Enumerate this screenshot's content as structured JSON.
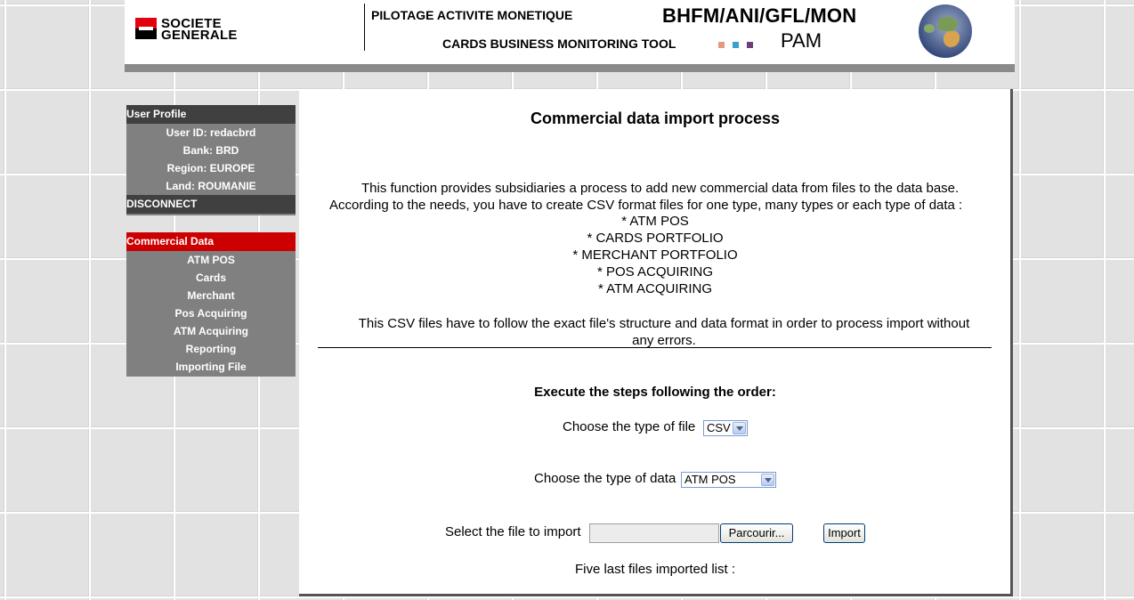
{
  "header": {
    "logo": {
      "line1": "SOCIETE",
      "line2": "GENERALE"
    },
    "title_fr": "PILOTAGE ACTIVITE MONETIQUE",
    "title_en": "CARDS BUSINESS MONITORING TOOL",
    "code": "BHFM/ANI/GFL/MON",
    "abbrev": "PAM",
    "dot_colors": [
      "#e39b7b",
      "#3aa0c9",
      "#6a3f7a"
    ],
    "globe_icon": "globe-icon"
  },
  "sidebar": {
    "profile": {
      "heading": "User Profile",
      "items": [
        {
          "label": "User ID: redacbrd"
        },
        {
          "label": "Bank: BRD"
        },
        {
          "label": "Region: EUROPE"
        },
        {
          "label": "Land: ROUMANIE"
        }
      ],
      "disconnect": "DISCONNECT"
    },
    "commercial": {
      "heading": "Commercial Data",
      "items": [
        {
          "label": "ATM POS"
        },
        {
          "label": "Cards"
        },
        {
          "label": "Merchant"
        },
        {
          "label": "Pos Acquiring"
        },
        {
          "label": "ATM Acquiring"
        },
        {
          "label": "Reporting"
        },
        {
          "label": "Importing File"
        }
      ]
    }
  },
  "main": {
    "title": "Commercial data import process",
    "description_line1": "This function provides subsidiaries a process to add new commercial data from files to the data base.",
    "description_line2": "According to the needs, you have to create CSV format files for one type, many types or each type of data :",
    "data_types": [
      "* ATM POS",
      "* CARDS PORTFOLIO",
      "* MERCHANT PORTFOLIO",
      "* POS ACQUIRING",
      "* ATM ACQUIRING"
    ],
    "note_line1": "This CSV files have to follow the exact file's structure and data format in order to process import without",
    "note_line2": "any errors.",
    "steps_title": "Execute the steps following the order:",
    "file_type_label": "Choose the type of file",
    "file_type_value": "CSV",
    "data_type_label": "Choose the type of data",
    "data_type_value": "ATM POS",
    "select_file_label": "Select the file to import",
    "browse_label": "Parcourir...",
    "import_label": "Import",
    "last_files_label": "Five last files imported list :"
  },
  "colors": {
    "accent_red": "#cc0000",
    "sidebar_gray": "#808080",
    "sidebar_dark": "#404040"
  }
}
